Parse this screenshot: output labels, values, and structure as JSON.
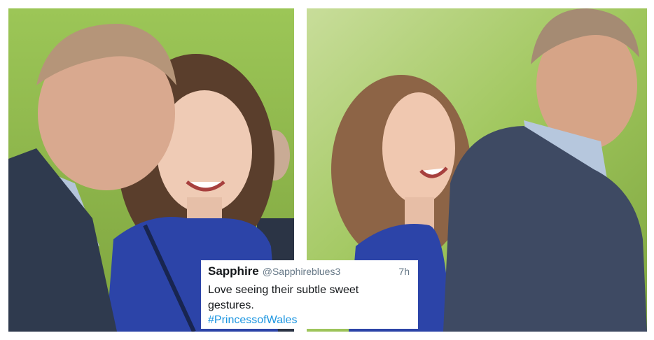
{
  "tweet": {
    "name": "Sapphire",
    "handle": "@Sapphireblues3",
    "time": "7h",
    "text": "Love seeing their subtle sweet gestures.",
    "hashtag": "#PrincessofWales",
    "hashtag_color": "#1b95e0"
  },
  "colors": {
    "background_green": "#8fbf4a",
    "blue_tweed": "#2c44a8",
    "navy_suit": "#2f3a4e",
    "grey_suit": "#3e4a63"
  }
}
